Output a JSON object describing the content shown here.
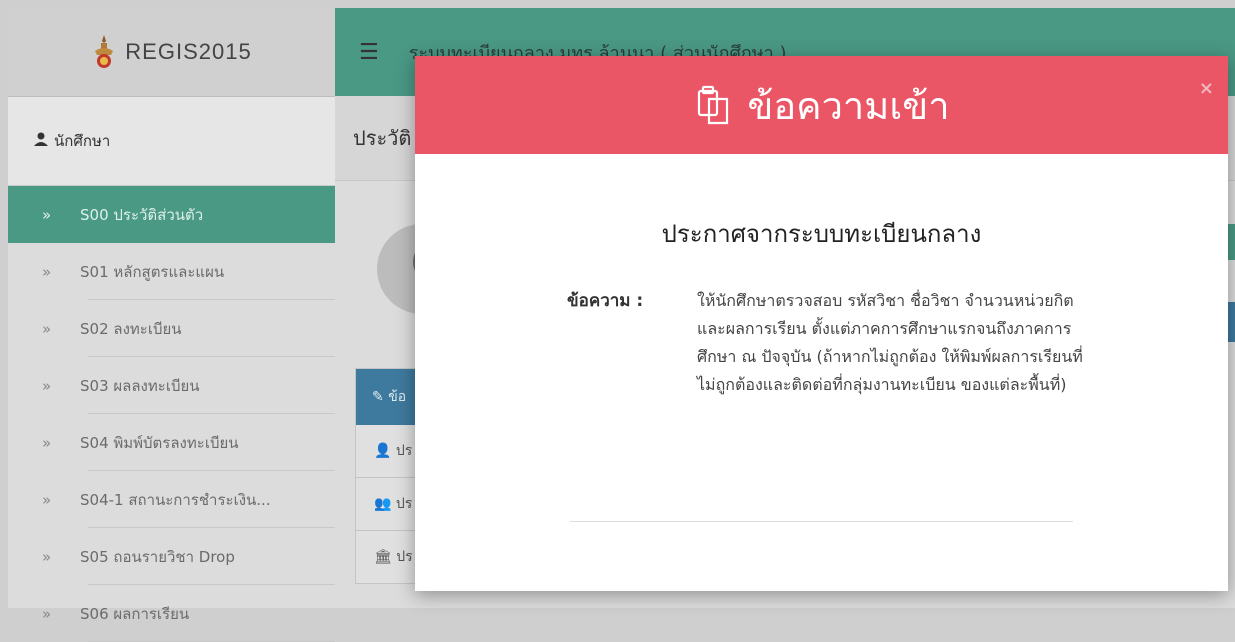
{
  "brand": {
    "name": "REGIS2015"
  },
  "sidebar": {
    "user_label": "นักศึกษา",
    "items": [
      {
        "label": "S00 ประวัติส่วนตัว",
        "active": true
      },
      {
        "label": "S01 หลักสูตรและแผน"
      },
      {
        "label": "S02 ลงทะเบียน"
      },
      {
        "label": "S03 ผลลงทะเบียน"
      },
      {
        "label": "S04 พิมพ์บัตรลงทะเบียน"
      },
      {
        "label": "S04-1 สถานะการชำระเงิน..."
      },
      {
        "label": "S05 ถอนรายวิชา Drop"
      },
      {
        "label": "S06 ผลการเรียน"
      }
    ]
  },
  "topbar": {
    "title": "ระบบทะเบียนกลาง มทร.ล้านนา ( ส่วนนักศึกษา )"
  },
  "page": {
    "heading": "ประวัติ",
    "card_title": "ข้อ",
    "card_rows": [
      "ปร",
      "ปร",
      "ปร"
    ]
  },
  "modal": {
    "title": "ข้อความเข้า",
    "close": "×",
    "announce_title": "ประกาศจากระบบทะเบียนกลาง",
    "message_label": "ข้อความ :",
    "message_text": "ให้นักศึกษาตรวจสอบ รหัสวิชา ชื่อวิชา จำนวนหน่วยกิต และผลการเรียน ตั้งแต่ภาคการศึกษาแรกจนถึงภาคการศึกษา ณ ปัจจุบัน (ถ้าหากไม่ถูกต้อง ให้พิมพ์ผลการเรียนที่ไม่ถูกต้องและติดต่อที่กลุ่มงานทะเบียน ของแต่ละพื้นที่)"
  },
  "colors": {
    "accent": "#4a9985",
    "modal_header": "#eb5667",
    "card_header": "#3e7a9e"
  }
}
